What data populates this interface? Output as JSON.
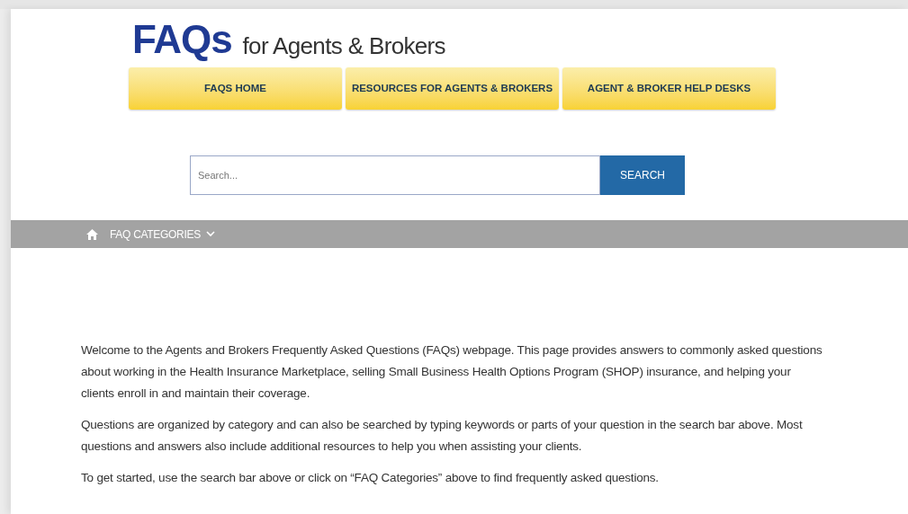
{
  "logo": {
    "mark": "FAQs",
    "tagline": "for Agents & Brokers"
  },
  "nav_buttons": [
    {
      "label": "FAQS HOME"
    },
    {
      "label": "RESOURCES FOR AGENTS & BROKERS"
    },
    {
      "label": "AGENT & BROKER HELP DESKS"
    }
  ],
  "search": {
    "placeholder": "Search...",
    "button": "SEARCH"
  },
  "category_bar": {
    "menu": "FAQ CATEGORIES"
  },
  "paragraphs": [
    "Welcome to the Agents and Brokers Frequently Asked Questions (FAQs) webpage. This page provides answers to commonly asked questions about working in the Health Insurance Marketplace, selling Small Business Health Options Program (SHOP) insurance, and helping your clients enroll in and maintain their coverage.",
    "Questions are organized by category and can also be searched by typing keywords or parts of your question in the search bar above. Most questions and answers also include additional resources to help you when assisting your clients.",
    "To get started, use the search bar above or click on “FAQ Categories” above to find frequently asked questions."
  ]
}
